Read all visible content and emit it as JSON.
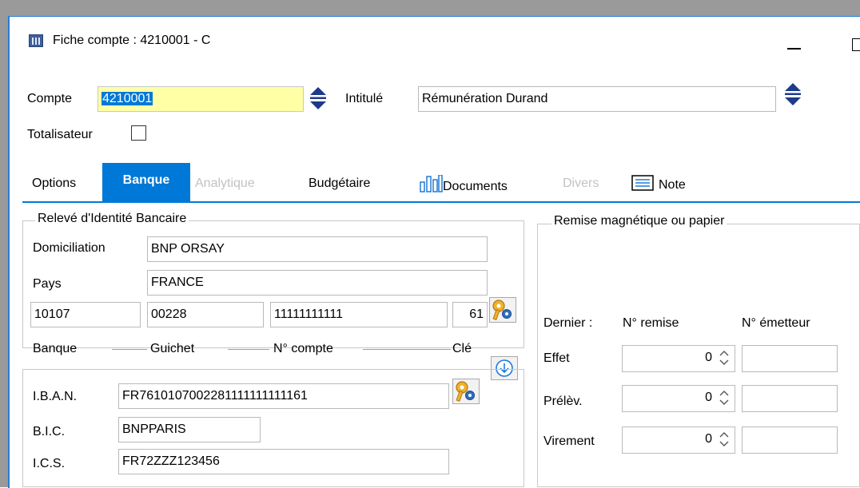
{
  "window": {
    "title": "Fiche compte : 4210001 - C"
  },
  "header": {
    "compte_label": "Compte",
    "compte_value": "4210001",
    "intitule_label": "Intitulé",
    "intitule_value": "Rémunération Durand",
    "totalisateur_label": "Totalisateur",
    "totalisateur_checked": false
  },
  "tabs": [
    {
      "label": "Options",
      "state": "normal"
    },
    {
      "label": "Banque",
      "state": "active"
    },
    {
      "label": "Analytique",
      "state": "disabled"
    },
    {
      "label": "Budgétaire",
      "state": "normal"
    },
    {
      "label": "Documents",
      "state": "normal",
      "icon": "bar-chart-icon"
    },
    {
      "label": "Divers",
      "state": "disabled"
    },
    {
      "label": "Note",
      "state": "normal",
      "icon": "note-icon"
    }
  ],
  "rib": {
    "group_title": "Relevé d'Identité Bancaire",
    "domiciliation_label": "Domiciliation",
    "domiciliation_value": "BNP ORSAY",
    "pays_label": "Pays",
    "pays_value": "FRANCE",
    "banque_value": "10107",
    "guichet_value": "00228",
    "compte_value": "11111111111",
    "cle_value": "61",
    "banque_label": "Banque",
    "guichet_label": "Guichet",
    "ncompte_label": "N° compte",
    "cle_label": "Clé"
  },
  "iban": {
    "iban_label": "I.B.A.N.",
    "iban_value": "FR7610107002281111111111161",
    "bic_label": "B.I.C.",
    "bic_value": "BNPPARIS",
    "ics_label": "I.C.S.",
    "ics_value": "FR72ZZZ123456"
  },
  "remise": {
    "group_title": "Remise magnétique ou papier",
    "dernier_label": "Dernier :",
    "nremise_label": "N° remise",
    "nemetteur_label": "N° émetteur",
    "rows": [
      {
        "label": "Effet",
        "value": "0",
        "emetteur": ""
      },
      {
        "label": "Prélèv.",
        "value": "0",
        "emetteur": ""
      },
      {
        "label": "Virement",
        "value": "0",
        "emetteur": ""
      }
    ]
  },
  "icons": {
    "app": "ledger-app-icon",
    "updown": "navigate-updown-icon",
    "settings_key": "key-gear-icon",
    "download": "download-circle-icon"
  },
  "colors": {
    "accent": "#0078d7",
    "highlight_field": "#ffffa6",
    "nav_arrow": "#1e3a8a"
  }
}
